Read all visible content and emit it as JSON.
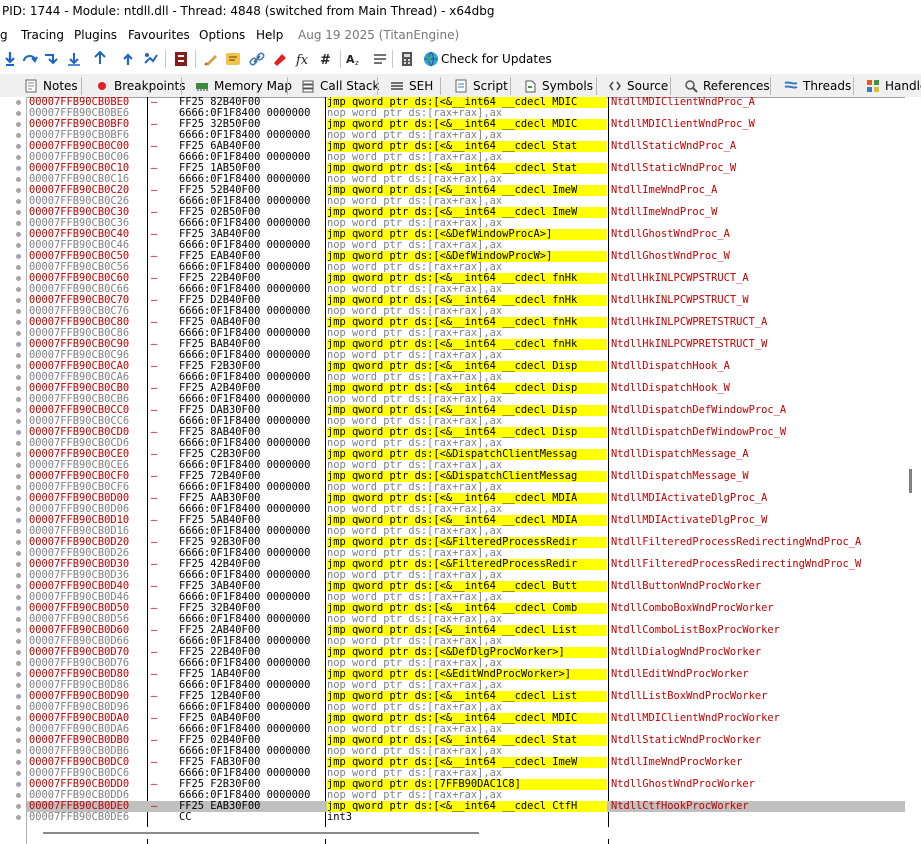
{
  "window": {
    "title": "PID: 1744 - Module: ntdll.dll - Thread: 4848 (switched from Main Thread) - x64dbg"
  },
  "menu": {
    "items": [
      "g",
      "Tracing",
      "Plugins",
      "Favourites",
      "Options",
      "Help",
      "Aug 19 2025 (TitanEngine)"
    ]
  },
  "toolbar": {
    "check_updates": "Check for Updates"
  },
  "tabs": [
    "Notes",
    "Breakpoints",
    "Memory Map",
    "Call Stack",
    "SEH",
    "Script",
    "Symbols",
    "Source",
    "References",
    "Threads",
    "Handles"
  ],
  "disasm": {
    "rows": [
      {
        "addr": "00007FFB90CB0BE0",
        "jmp": true,
        "bytes": "FF25 82B40F00",
        "instr": "jmp qword ptr ds:[<&__int64 __cdecl MDIC",
        "comment": "NtdllMDIClientWndProc_A"
      },
      {
        "addr": "00007FFB90CB0BE6",
        "jmp": false,
        "bytes": "6666:0F1F8400 0000000",
        "instr": "nop word ptr ds:[rax+rax],ax",
        "comment": ""
      },
      {
        "addr": "00007FFB90CB0BF0",
        "jmp": true,
        "bytes": "FF25 32B50F00",
        "instr": "jmp qword ptr ds:[<&__int64 __cdecl MDIC",
        "comment": "NtdllMDIClientWndProc_W"
      },
      {
        "addr": "00007FFB90CB0BF6",
        "jmp": false,
        "bytes": "6666:0F1F8400 0000000",
        "instr": "nop word ptr ds:[rax+rax],ax",
        "comment": ""
      },
      {
        "addr": "00007FFB90CB0C00",
        "jmp": true,
        "bytes": "FF25 6AB40F00",
        "instr": "jmp qword ptr ds:[<&__int64 __cdecl Stat",
        "comment": "NtdllStaticWndProc_A"
      },
      {
        "addr": "00007FFB90CB0C06",
        "jmp": false,
        "bytes": "6666:0F1F8400 0000000",
        "instr": "nop word ptr ds:[rax+rax],ax",
        "comment": ""
      },
      {
        "addr": "00007FFB90CB0C10",
        "jmp": true,
        "bytes": "FF25 1AB50F00",
        "instr": "jmp qword ptr ds:[<&__int64 __cdecl Stat",
        "comment": "NtdllStaticWndProc_W"
      },
      {
        "addr": "00007FFB90CB0C16",
        "jmp": false,
        "bytes": "6666:0F1F8400 0000000",
        "instr": "nop word ptr ds:[rax+rax],ax",
        "comment": ""
      },
      {
        "addr": "00007FFB90CB0C20",
        "jmp": true,
        "bytes": "FF25 52B40F00",
        "instr": "jmp qword ptr ds:[<&__int64 __cdecl ImeW",
        "comment": "NtdllImeWndProc_A"
      },
      {
        "addr": "00007FFB90CB0C26",
        "jmp": false,
        "bytes": "6666:0F1F8400 0000000",
        "instr": "nop word ptr ds:[rax+rax],ax",
        "comment": ""
      },
      {
        "addr": "00007FFB90CB0C30",
        "jmp": true,
        "bytes": "FF25 02B50F00",
        "instr": "jmp qword ptr ds:[<&__int64 __cdecl ImeW",
        "comment": "NtdllImeWndProc_W"
      },
      {
        "addr": "00007FFB90CB0C36",
        "jmp": false,
        "bytes": "6666:0F1F8400 0000000",
        "instr": "nop word ptr ds:[rax+rax],ax",
        "comment": ""
      },
      {
        "addr": "00007FFB90CB0C40",
        "jmp": true,
        "bytes": "FF25 3AB40F00",
        "instr": "jmp qword ptr ds:[<&DefWindowProcA>]",
        "comment": "NtdllGhostWndProc_A"
      },
      {
        "addr": "00007FFB90CB0C46",
        "jmp": false,
        "bytes": "6666:0F1F8400 0000000",
        "instr": "nop word ptr ds:[rax+rax],ax",
        "comment": ""
      },
      {
        "addr": "00007FFB90CB0C50",
        "jmp": true,
        "bytes": "FF25 EAB40F00",
        "instr": "jmp qword ptr ds:[<&DefWindowProcW>]",
        "comment": "NtdllGhostWndProc_W"
      },
      {
        "addr": "00007FFB90CB0C56",
        "jmp": false,
        "bytes": "6666:0F1F8400 0000000",
        "instr": "nop word ptr ds:[rax+rax],ax",
        "comment": ""
      },
      {
        "addr": "00007FFB90CB0C60",
        "jmp": true,
        "bytes": "FF25 22B40F00",
        "instr": "jmp qword ptr ds:[<&__int64 __cdecl fnHk",
        "comment": "NtdllHkINLPCWPSTRUCT_A"
      },
      {
        "addr": "00007FFB90CB0C66",
        "jmp": false,
        "bytes": "6666:0F1F8400 0000000",
        "instr": "nop word ptr ds:[rax+rax],ax",
        "comment": ""
      },
      {
        "addr": "00007FFB90CB0C70",
        "jmp": true,
        "bytes": "FF25 D2B40F00",
        "instr": "jmp qword ptr ds:[<&__int64 __cdecl fnHk",
        "comment": "NtdllHkINLPCWPSTRUCT_W"
      },
      {
        "addr": "00007FFB90CB0C76",
        "jmp": false,
        "bytes": "6666:0F1F8400 0000000",
        "instr": "nop word ptr ds:[rax+rax],ax",
        "comment": ""
      },
      {
        "addr": "00007FFB90CB0C80",
        "jmp": true,
        "bytes": "FF25 0AB40F00",
        "instr": "jmp qword ptr ds:[<&__int64 __cdecl fnHk",
        "comment": "NtdllHkINLPCWPRETSTRUCT_A"
      },
      {
        "addr": "00007FFB90CB0C86",
        "jmp": false,
        "bytes": "6666:0F1F8400 0000000",
        "instr": "nop word ptr ds:[rax+rax],ax",
        "comment": ""
      },
      {
        "addr": "00007FFB90CB0C90",
        "jmp": true,
        "bytes": "FF25 BAB40F00",
        "instr": "jmp qword ptr ds:[<&__int64 __cdecl fnHk",
        "comment": "NtdllHkINLPCWPRETSTRUCT_W"
      },
      {
        "addr": "00007FFB90CB0C96",
        "jmp": false,
        "bytes": "6666:0F1F8400 0000000",
        "instr": "nop word ptr ds:[rax+rax],ax",
        "comment": ""
      },
      {
        "addr": "00007FFB90CB0CA0",
        "jmp": true,
        "bytes": "FF25 F2B30F00",
        "instr": "jmp qword ptr ds:[<&__int64 __cdecl Disp",
        "comment": "NtdllDispatchHook_A"
      },
      {
        "addr": "00007FFB90CB0CA6",
        "jmp": false,
        "bytes": "6666:0F1F8400 0000000",
        "instr": "nop word ptr ds:[rax+rax],ax",
        "comment": ""
      },
      {
        "addr": "00007FFB90CB0CB0",
        "jmp": true,
        "bytes": "FF25 A2B40F00",
        "instr": "jmp qword ptr ds:[<&__int64 __cdecl Disp",
        "comment": "NtdllDispatchHook_W"
      },
      {
        "addr": "00007FFB90CB0CB6",
        "jmp": false,
        "bytes": "6666:0F1F8400 0000000",
        "instr": "nop word ptr ds:[rax+rax],ax",
        "comment": ""
      },
      {
        "addr": "00007FFB90CB0CC0",
        "jmp": true,
        "bytes": "FF25 DAB30F00",
        "instr": "jmp qword ptr ds:[<&__int64 __cdecl Disp",
        "comment": "NtdllDispatchDefWindowProc_A"
      },
      {
        "addr": "00007FFB90CB0CC6",
        "jmp": false,
        "bytes": "6666:0F1F8400 0000000",
        "instr": "nop word ptr ds:[rax+rax],ax",
        "comment": ""
      },
      {
        "addr": "00007FFB90CB0CD0",
        "jmp": true,
        "bytes": "FF25 8AB40F00",
        "instr": "jmp qword ptr ds:[<&__int64 __cdecl Disp",
        "comment": "NtdllDispatchDefWindowProc_W"
      },
      {
        "addr": "00007FFB90CB0CD6",
        "jmp": false,
        "bytes": "6666:0F1F8400 0000000",
        "instr": "nop word ptr ds:[rax+rax],ax",
        "comment": ""
      },
      {
        "addr": "00007FFB90CB0CE0",
        "jmp": true,
        "bytes": "FF25 C2B30F00",
        "instr": "jmp qword ptr ds:[<&DispatchClientMessag",
        "comment": "NtdllDispatchMessage_A"
      },
      {
        "addr": "00007FFB90CB0CE6",
        "jmp": false,
        "bytes": "6666:0F1F8400 0000000",
        "instr": "nop word ptr ds:[rax+rax],ax",
        "comment": ""
      },
      {
        "addr": "00007FFB90CB0CF0",
        "jmp": true,
        "bytes": "FF25 72B40F00",
        "instr": "jmp qword ptr ds:[<&DispatchClientMessag",
        "comment": "NtdllDispatchMessage_W"
      },
      {
        "addr": "00007FFB90CB0CF6",
        "jmp": false,
        "bytes": "6666:0F1F8400 0000000",
        "instr": "nop word ptr ds:[rax+rax],ax",
        "comment": ""
      },
      {
        "addr": "00007FFB90CB0D00",
        "jmp": true,
        "bytes": "FF25 AAB30F00",
        "instr": "jmp qword ptr ds:[<&__int64 __cdecl MDIA",
        "comment": "NtdllMDIActivateDlgProc_A"
      },
      {
        "addr": "00007FFB90CB0D06",
        "jmp": false,
        "bytes": "6666:0F1F8400 0000000",
        "instr": "nop word ptr ds:[rax+rax],ax",
        "comment": ""
      },
      {
        "addr": "00007FFB90CB0D10",
        "jmp": true,
        "bytes": "FF25 5AB40F00",
        "instr": "jmp qword ptr ds:[<&__int64 __cdecl MDIA",
        "comment": "NtdllMDIActivateDlgProc_W"
      },
      {
        "addr": "00007FFB90CB0D16",
        "jmp": false,
        "bytes": "6666:0F1F8400 0000000",
        "instr": "nop word ptr ds:[rax+rax],ax",
        "comment": ""
      },
      {
        "addr": "00007FFB90CB0D20",
        "jmp": true,
        "bytes": "FF25 92B30F00",
        "instr": "jmp qword ptr ds:[<&FilteredProcessRedir",
        "comment": "NtdllFilteredProcessRedirectingWndProc_A"
      },
      {
        "addr": "00007FFB90CB0D26",
        "jmp": false,
        "bytes": "6666:0F1F8400 0000000",
        "instr": "nop word ptr ds:[rax+rax],ax",
        "comment": ""
      },
      {
        "addr": "00007FFB90CB0D30",
        "jmp": true,
        "bytes": "FF25 42B40F00",
        "instr": "jmp qword ptr ds:[<&FilteredProcessRedir",
        "comment": "NtdllFilteredProcessRedirectingWndProc_W"
      },
      {
        "addr": "00007FFB90CB0D36",
        "jmp": false,
        "bytes": "6666:0F1F8400 0000000",
        "instr": "nop word ptr ds:[rax+rax],ax",
        "comment": ""
      },
      {
        "addr": "00007FFB90CB0D40",
        "jmp": true,
        "bytes": "FF25 3AB40F00",
        "instr": "jmp qword ptr ds:[<&__int64 __cdecl Butt",
        "comment": "NtdllButtonWndProcWorker"
      },
      {
        "addr": "00007FFB90CB0D46",
        "jmp": false,
        "bytes": "6666:0F1F8400 0000000",
        "instr": "nop word ptr ds:[rax+rax],ax",
        "comment": ""
      },
      {
        "addr": "00007FFB90CB0D50",
        "jmp": true,
        "bytes": "FF25 32B40F00",
        "instr": "jmp qword ptr ds:[<&__int64 __cdecl Comb",
        "comment": "NtdllComboBoxWndProcWorker"
      },
      {
        "addr": "00007FFB90CB0D56",
        "jmp": false,
        "bytes": "6666:0F1F8400 0000000",
        "instr": "nop word ptr ds:[rax+rax],ax",
        "comment": ""
      },
      {
        "addr": "00007FFB90CB0D60",
        "jmp": true,
        "bytes": "FF25 2AB40F00",
        "instr": "jmp qword ptr ds:[<&__int64 __cdecl List",
        "comment": "NtdllComboListBoxProcWorker"
      },
      {
        "addr": "00007FFB90CB0D66",
        "jmp": false,
        "bytes": "6666:0F1F8400 0000000",
        "instr": "nop word ptr ds:[rax+rax],ax",
        "comment": ""
      },
      {
        "addr": "00007FFB90CB0D70",
        "jmp": true,
        "bytes": "FF25 22B40F00",
        "instr": "jmp qword ptr ds:[<&DefDlgProcWorker>]",
        "comment": "NtdllDialogWndProcWorker"
      },
      {
        "addr": "00007FFB90CB0D76",
        "jmp": false,
        "bytes": "6666:0F1F8400 0000000",
        "instr": "nop word ptr ds:[rax+rax],ax",
        "comment": ""
      },
      {
        "addr": "00007FFB90CB0D80",
        "jmp": true,
        "bytes": "FF25 1AB40F00",
        "instr": "jmp qword ptr ds:[<&EditWndProcWorker>]",
        "comment": "NtdllEditWndProcWorker"
      },
      {
        "addr": "00007FFB90CB0D86",
        "jmp": false,
        "bytes": "6666:0F1F8400 0000000",
        "instr": "nop word ptr ds:[rax+rax],ax",
        "comment": ""
      },
      {
        "addr": "00007FFB90CB0D90",
        "jmp": true,
        "bytes": "FF25 12B40F00",
        "instr": "jmp qword ptr ds:[<&__int64 __cdecl List",
        "comment": "NtdllListBoxWndProcWorker"
      },
      {
        "addr": "00007FFB90CB0D96",
        "jmp": false,
        "bytes": "6666:0F1F8400 0000000",
        "instr": "nop word ptr ds:[rax+rax],ax",
        "comment": ""
      },
      {
        "addr": "00007FFB90CB0DA0",
        "jmp": true,
        "bytes": "FF25 0AB40F00",
        "instr": "jmp qword ptr ds:[<&__int64 __cdecl MDIC",
        "comment": "NtdllMDIClientWndProcWorker"
      },
      {
        "addr": "00007FFB90CB0DA6",
        "jmp": false,
        "bytes": "6666:0F1F8400 0000000",
        "instr": "nop word ptr ds:[rax+rax],ax",
        "comment": ""
      },
      {
        "addr": "00007FFB90CB0DB0",
        "jmp": true,
        "bytes": "FF25 02B40F00",
        "instr": "jmp qword ptr ds:[<&__int64 __cdecl Stat",
        "comment": "NtdllStaticWndProcWorker"
      },
      {
        "addr": "00007FFB90CB0DB6",
        "jmp": false,
        "bytes": "6666:0F1F8400 0000000",
        "instr": "nop word ptr ds:[rax+rax],ax",
        "comment": ""
      },
      {
        "addr": "00007FFB90CB0DC0",
        "jmp": true,
        "bytes": "FF25 FAB30F00",
        "instr": "jmp qword ptr ds:[<&__int64 __cdecl ImeW",
        "comment": "NtdllImeWndProcWorker"
      },
      {
        "addr": "00007FFB90CB0DC6",
        "jmp": false,
        "bytes": "6666:0F1F8400 0000000",
        "instr": "nop word ptr ds:[rax+rax],ax",
        "comment": ""
      },
      {
        "addr": "00007FFB90CB0DD0",
        "jmp": true,
        "bytes": "FF25 F2B30F00",
        "instr": "jmp qword ptr ds:[7FFB90DAC1C8]",
        "comment": "NtdllGhostWndProcWorker"
      },
      {
        "addr": "00007FFB90CB0DD6",
        "jmp": false,
        "bytes": "6666:0F1F8400 0000000",
        "instr": "nop word ptr ds:[rax+rax],ax",
        "comment": ""
      },
      {
        "addr": "00007FFB90CB0DE0",
        "jmp": true,
        "sel": true,
        "bytes": "FF25 EAB30F00",
        "instr": "jmp qword ptr ds:[<&__int64 __cdecl CtfH",
        "comment": "NtdllCtfHookProcWorker"
      },
      {
        "addr": "00007FFB90CB0DE6",
        "jmp": false,
        "int3": true,
        "bytes": "CC",
        "instr": "int3",
        "comment": ""
      }
    ]
  }
}
